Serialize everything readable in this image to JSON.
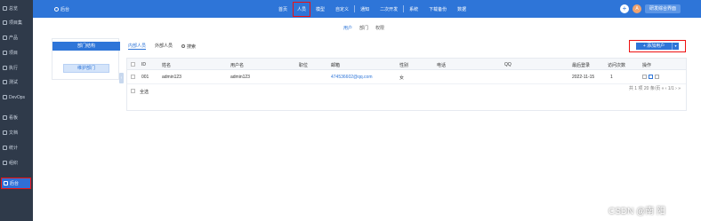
{
  "sidebar": {
    "items": [
      {
        "label": "总览",
        "icon": "grid-icon"
      },
      {
        "label": "项目集",
        "icon": "folder-icon"
      },
      {
        "label": "产品",
        "icon": "box-icon"
      },
      {
        "label": "项目",
        "icon": "project-icon"
      },
      {
        "label": "执行",
        "icon": "run-icon"
      },
      {
        "label": "测试",
        "icon": "bug-icon"
      },
      {
        "label": "DevOps",
        "icon": "infinity-icon"
      },
      {
        "label": "看板",
        "icon": "kanban-icon"
      },
      {
        "label": "文档",
        "icon": "doc-icon"
      },
      {
        "label": "统计",
        "icon": "chart-icon"
      },
      {
        "label": "组织",
        "icon": "org-icon"
      },
      {
        "label": "后台",
        "icon": "settings-icon"
      }
    ]
  },
  "topbar": {
    "brand": "后台",
    "nav": [
      "首页",
      "人员",
      "模型",
      "自定义",
      "通知",
      "二次开发",
      "系统",
      "下载备份",
      "数据"
    ],
    "avatar_letter": "A",
    "org_button": "研发综合界面"
  },
  "subtabs": [
    "用户",
    "部门",
    "权限"
  ],
  "left_panel": {
    "title": "部门结构",
    "button": "维护部门"
  },
  "user_tabs": {
    "internal": "内部人员",
    "external": "外部人员",
    "search": "搜索"
  },
  "add_user": "添加用户",
  "table": {
    "headers": [
      "ID",
      "姓名",
      "用户名",
      "职位",
      "邮箱",
      "性别",
      "电话",
      "QQ",
      "最后登录",
      "访问次数",
      "操作"
    ],
    "rows": [
      {
        "id": "001",
        "name": "admin123",
        "username": "admin123",
        "position": "",
        "email": "474536602@qq.com",
        "gender": "女",
        "phone": "",
        "qq": "",
        "last_login": "2022-11-15",
        "visits": "1"
      }
    ],
    "select_all": "全选",
    "pager": "共 1 项   20 条/页   « ‹ 1/1 › »"
  },
  "watermark": "CSDN @南 阳",
  "colors": {
    "primary": "#2e75d8",
    "sidebar": "#2f3a4a",
    "highlight": "#e11111"
  }
}
